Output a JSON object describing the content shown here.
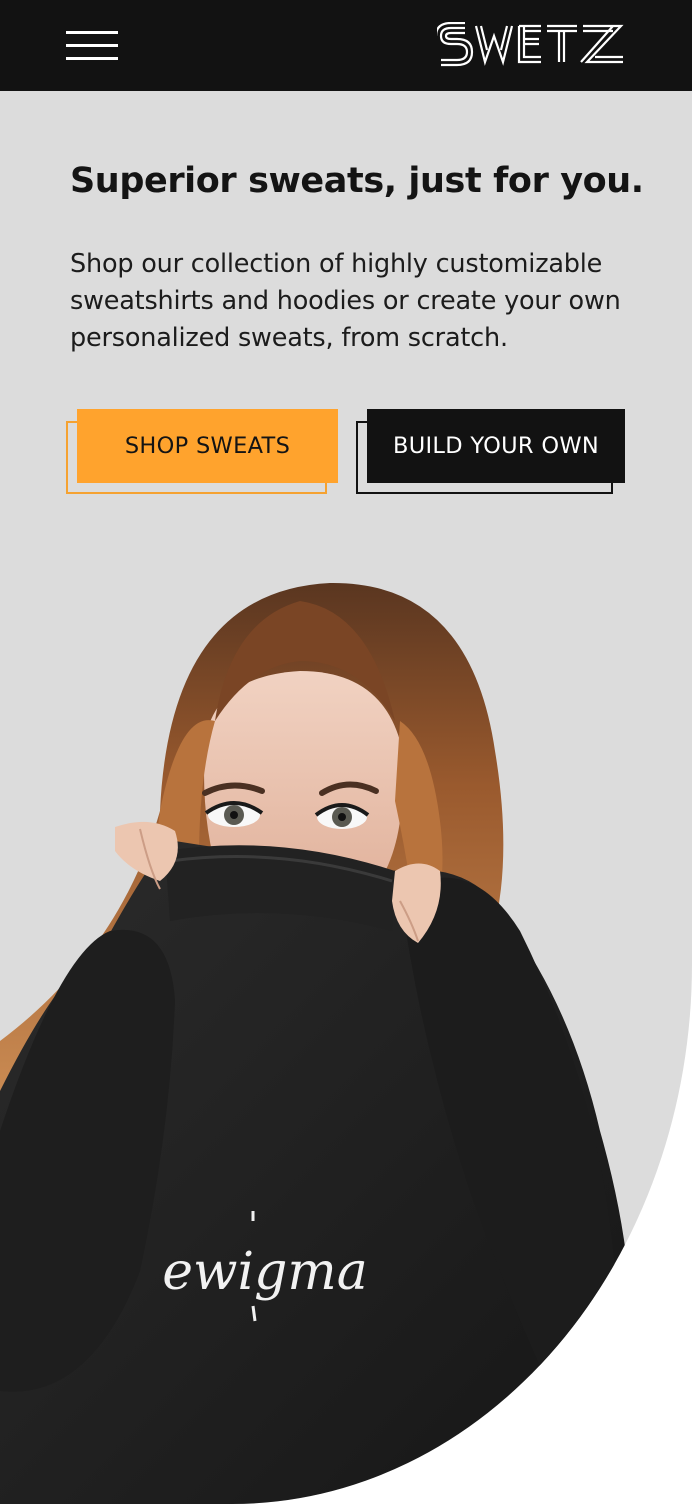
{
  "header": {
    "brand": "SWETZ",
    "menu_icon": "hamburger-menu-icon",
    "background": "#121212"
  },
  "hero": {
    "title": "Superior sweats, just for you.",
    "description": "Shop our collection of highly customizable sweatshirts and hoodies or create your own personalized sweats, from scratch.",
    "background": "#dcdcdc",
    "buttons": {
      "primary_label": "SHOP SWEATS",
      "secondary_label": "BUILD YOUR OWN"
    },
    "accent_color": "#ffa32d",
    "image": {
      "description_icon": "model-photo",
      "shirt_print": "ewigma"
    }
  }
}
